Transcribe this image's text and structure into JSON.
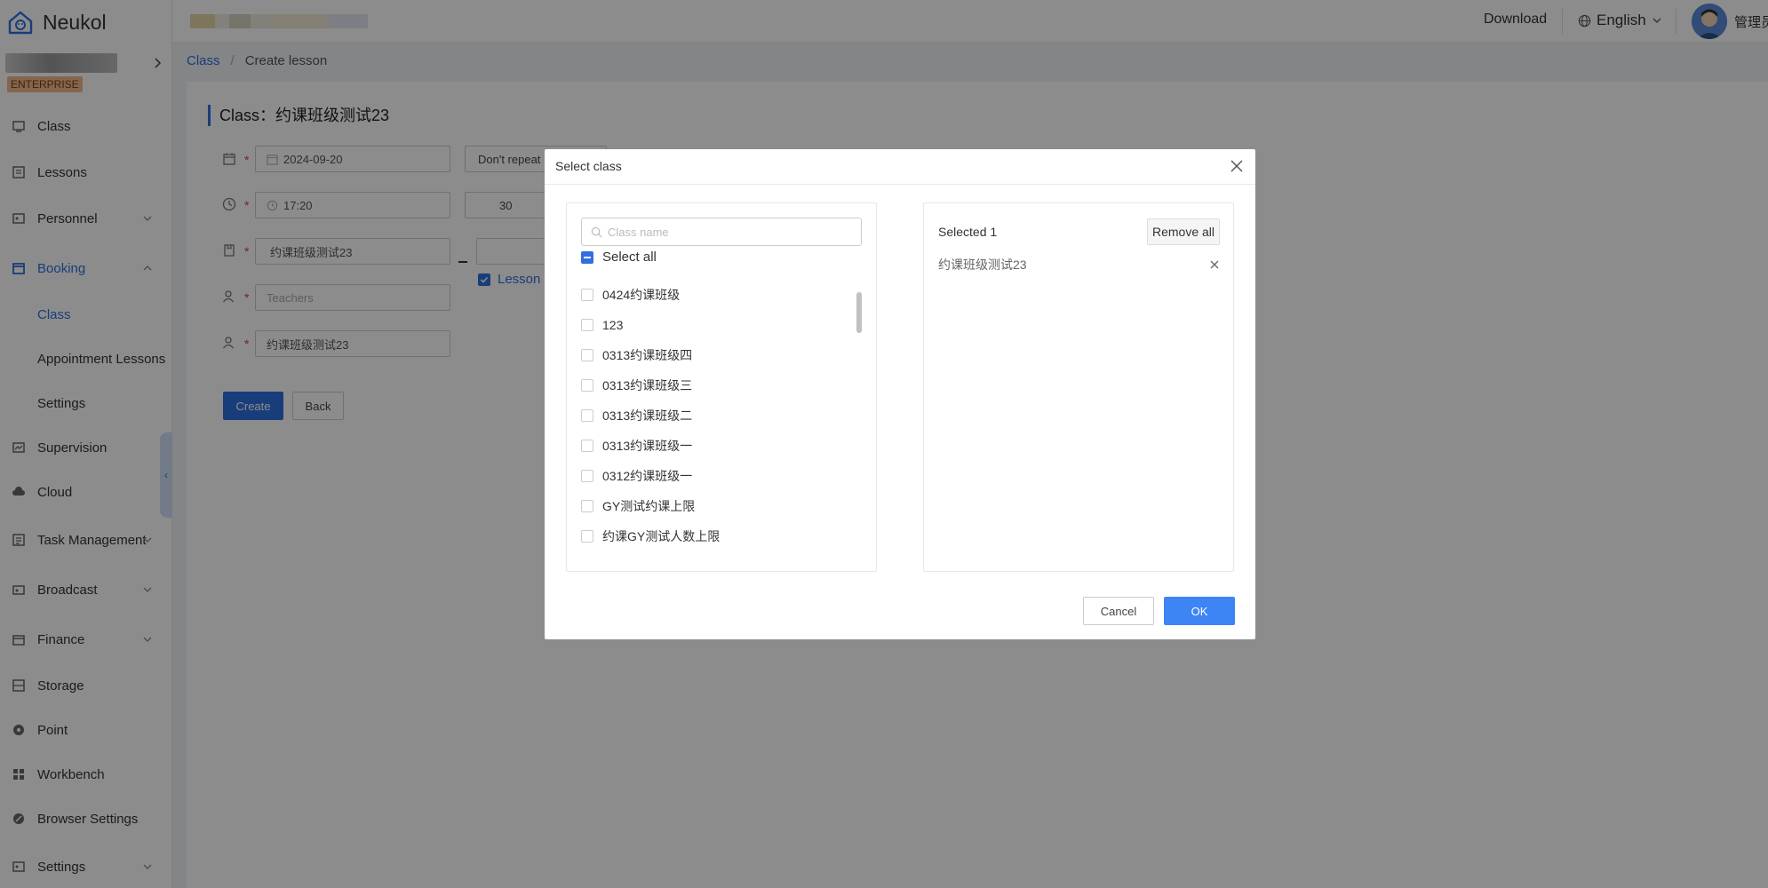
{
  "app": {
    "name": "Neukol",
    "enterprise_badge": "ENTERPRISE"
  },
  "header": {
    "download": "Download",
    "language": "English",
    "admin_name": "管理员"
  },
  "sidebar": {
    "items": [
      {
        "label": "Class",
        "icon": "class-icon"
      },
      {
        "label": "Lessons",
        "icon": "lessons-icon"
      },
      {
        "label": "Personnel",
        "icon": "personnel-icon"
      },
      {
        "label": "Booking",
        "icon": "booking-icon"
      },
      {
        "label": "Class"
      },
      {
        "label": "Appointment Lessons"
      },
      {
        "label": "Settings"
      },
      {
        "label": "Supervision",
        "icon": "supervision-icon"
      },
      {
        "label": "Cloud",
        "icon": "cloud-icon"
      },
      {
        "label": "Task Management",
        "icon": "task-icon"
      },
      {
        "label": "Broadcast",
        "icon": "broadcast-icon"
      },
      {
        "label": "Finance",
        "icon": "finance-icon"
      },
      {
        "label": "Storage",
        "icon": "storage-icon"
      },
      {
        "label": "Point",
        "icon": "point-icon"
      },
      {
        "label": "Workbench",
        "icon": "workbench-icon"
      },
      {
        "label": "Browser Settings",
        "icon": "browser-settings-icon"
      },
      {
        "label": "Settings",
        "icon": "settings-icon"
      }
    ]
  },
  "breadcrumb": {
    "root": "Class",
    "separator": "/",
    "current": "Create lesson"
  },
  "form": {
    "title": "Class：约课班级测试23",
    "date": "2024-09-20",
    "repeat": "Don't repeat",
    "time": "17:20",
    "duration": "30",
    "lesson_name": "约课班级测试23",
    "lesson_checkbox": "Lesson",
    "teachers_placeholder": "Teachers",
    "class_name": "约课班级测试23",
    "create_button": "Create",
    "back_button": "Back"
  },
  "modal": {
    "title": "Select class",
    "search_placeholder": "Class name",
    "select_all": "Select all",
    "options": [
      "0424约课班级",
      "123",
      "0313约课班级四",
      "0313约课班级三",
      "0313约课班级二",
      "0313约课班级一",
      "0312约课班级一",
      "GY测试约课上限",
      "约课GY测试人数上限"
    ],
    "selected_count": "Selected 1",
    "remove_all": "Remove all",
    "selected_items": [
      "约课班级测试23"
    ],
    "cancel": "Cancel",
    "ok": "OK"
  },
  "colors": {
    "accent": "#2f6fe0",
    "ok_button": "#3d85f5",
    "enterprise_badge": "#f0b98f"
  }
}
